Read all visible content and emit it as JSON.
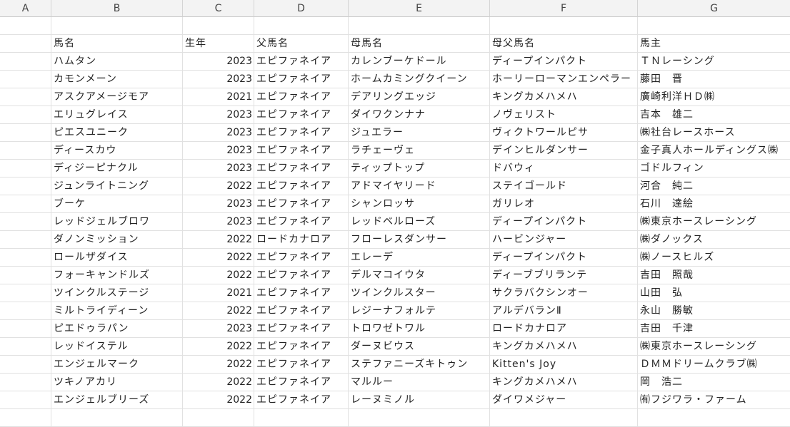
{
  "columns": [
    "A",
    "B",
    "C",
    "D",
    "E",
    "F",
    "G"
  ],
  "header_row": [
    "",
    "馬名",
    "生年",
    "父馬名",
    "母馬名",
    "母父馬名",
    "馬主"
  ],
  "rows": [
    [
      "ハムタン",
      "2023",
      "エピファネイア",
      "カレンブーケドール",
      "ディープインパクト",
      "ＴＮレーシング"
    ],
    [
      "カモンメーン",
      "2023",
      "エピファネイア",
      "ホームカミングクイーン",
      "ホーリーローマンエンペラー",
      "藤田　晋"
    ],
    [
      "アスクアメージモア",
      "2021",
      "エピファネイア",
      "デアリングエッジ",
      "キングカメハメハ",
      "廣崎利洋ＨＤ㈱"
    ],
    [
      "エリュグレイス",
      "2023",
      "エピファネイア",
      "ダイワクンナナ",
      "ノヴェリスト",
      "吉本　雄二"
    ],
    [
      "ピエスユニーク",
      "2023",
      "エピファネイア",
      "ジュエラー",
      "ヴィクトワールピサ",
      "㈱社台レースホース"
    ],
    [
      "ディースカウ",
      "2023",
      "エピファネイア",
      "ラチェーヴェ",
      "デインヒルダンサー",
      "金子真人ホールディングス㈱"
    ],
    [
      "ディジーピナクル",
      "2023",
      "エピファネイア",
      "ティップトップ",
      "ドバウィ",
      "ゴドルフィン"
    ],
    [
      "ジュンライトニング",
      "2022",
      "エピファネイア",
      "アドマイヤリード",
      "ステイゴールド",
      "河合　純二"
    ],
    [
      "ブーケ",
      "2023",
      "エピファネイア",
      "シャンロッサ",
      "ガリレオ",
      "石川　達絵"
    ],
    [
      "レッドジェルブロワ",
      "2023",
      "エピファネイア",
      "レッドベルローズ",
      "ディープインパクト",
      "㈱東京ホースレーシング"
    ],
    [
      "ダノンミッション",
      "2022",
      "ロードカナロア",
      "フローレスダンサー",
      "ハービンジャー",
      "㈱ダノックス"
    ],
    [
      "ロールザダイス",
      "2022",
      "エピファネイア",
      "エレーデ",
      "ディープインパクト",
      "㈱ノースヒルズ"
    ],
    [
      "フォーキャンドルズ",
      "2022",
      "エピファネイア",
      "デルマコイウタ",
      "ディーブブリランテ",
      "吉田　照哉"
    ],
    [
      "ツインクルステージ",
      "2021",
      "エピファネイア",
      "ツインクルスター",
      "サクラバクシンオー",
      "山田　弘"
    ],
    [
      "ミルトライディーン",
      "2022",
      "エピファネイア",
      "レジーナフォルテ",
      "アルデバランⅡ",
      "永山　勝敏"
    ],
    [
      "ピエドゥラパン",
      "2023",
      "エピファネイア",
      "トロワゼトワル",
      "ロードカナロア",
      "吉田　千津"
    ],
    [
      "レッドイステル",
      "2022",
      "エピファネイア",
      "ダーヌビウス",
      "キングカメハメハ",
      "㈱東京ホースレーシング"
    ],
    [
      "エンジェルマーク",
      "2022",
      "エピファネイア",
      "ステファニーズキトゥン",
      "Kitten's Joy",
      "ＤＭＭドリームクラブ㈱"
    ],
    [
      "ツキノアカリ",
      "2022",
      "エピファネイア",
      "マルルー",
      "キングカメハメハ",
      "岡　浩二"
    ],
    [
      "エンジェルブリーズ",
      "2022",
      "エピファネイア",
      "レーヌミノル",
      "ダイワメジャー",
      "㈲フジワラ・ファーム"
    ]
  ]
}
